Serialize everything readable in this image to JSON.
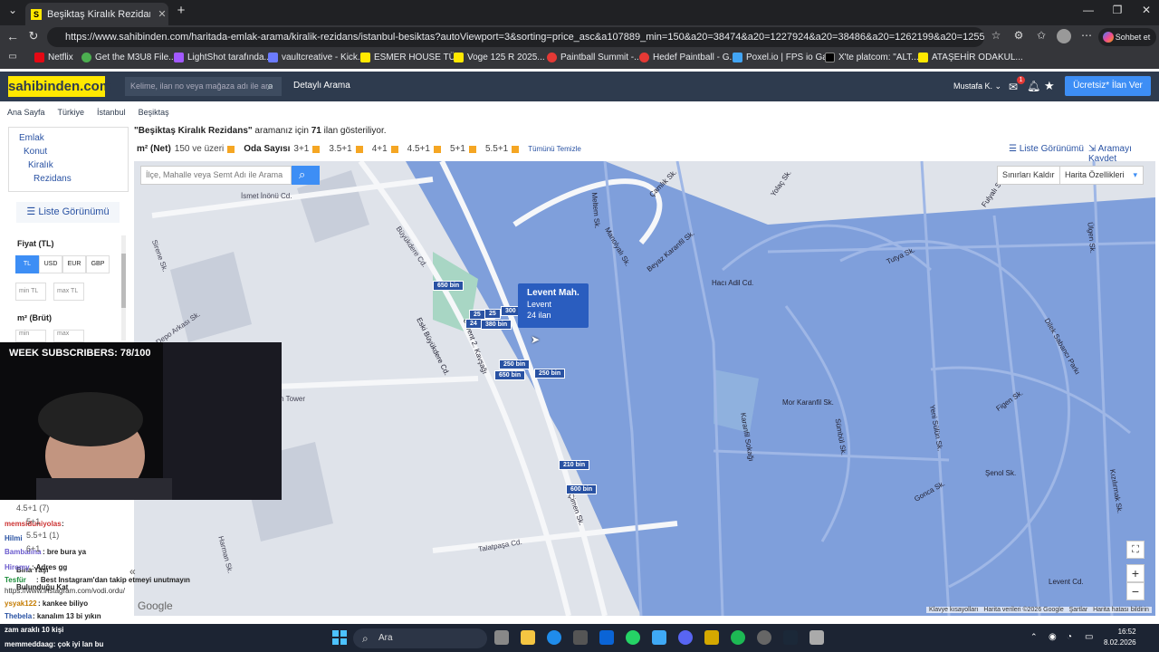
{
  "browser": {
    "tab_title": "Beşiktaş Kiralık Rezidans Fiyatları ",
    "url": "https://www.sahibinden.com/haritada-emlak-arama/kiralik-rezidans/istanbul-besiktas?autoViewport=3&sorting=price_asc&a107889_min=150&a20=38474&a20=1227924&a20=38486&a20=1262199&a20=1255142&a20=38471&a20=122...",
    "profile_btn": "Sohbet et",
    "bookmarks": [
      "Netflix",
      "Get the M3U8 File...",
      "LightShot tarafında...",
      "vaultcreative - Kick...",
      "ESMER HOUSE TÜ...",
      "Voge 125 R 2025...",
      "Paintball Summit -...",
      "Hedef Paintball - G...",
      "Poxel.io | FPS io Ga...",
      "X'te platcom: \"ALT...",
      "ATAŞEHİR ODAKUL..."
    ]
  },
  "header": {
    "logo": "sahibinden.com",
    "search_placeholder": "Kelime, ilan no veya mağaza adı ile ara",
    "detailed_search": "Detaylı Arama",
    "user": "Mustafa K.",
    "notif_count": "1",
    "free_ad": "Ücretsiz* İlan Ver"
  },
  "breadcrumb": [
    "Ana Sayfa",
    "Türkiye",
    "İstanbul",
    "Beşiktaş"
  ],
  "sidebar": {
    "categories": [
      "Emlak",
      "Konut",
      "Kiralık",
      "Rezidans"
    ],
    "list_view": "Liste Görünümü",
    "price_label": "Fiyat (TL)",
    "currencies": [
      "TL",
      "USD",
      "EUR",
      "GBP"
    ],
    "min_tl": "min TL",
    "max_tl": "max TL",
    "area_label": "m² (Brüt)",
    "min": "min",
    "max": "max"
  },
  "results": {
    "query": "\"Beşiktaş Kiralık Rezidans\"",
    "text_pre": " aramanız için ",
    "count": "71",
    "text_post": " ilan gösteriliyor."
  },
  "filters": {
    "net_label": "m² (Net)",
    "net_value": "150 ve üzeri",
    "rooms_label": "Oda Sayısı",
    "rooms": [
      "3+1",
      "3.5+1",
      "4+1",
      "4.5+1",
      "5+1",
      "5.5+1"
    ],
    "clear_all": "Tümünü Temizle",
    "list_view": "Liste Görünümü",
    "save_search": "Aramayı Kaydet"
  },
  "map": {
    "search_placeholder": "İlçe, Mahalle veya Semt  Adı ile Arama",
    "remove_bounds": "Sınırları Kaldır",
    "map_features": "Harita Özellikleri",
    "tooltip": {
      "title": "Levent Mah.",
      "sub": "Levent",
      "count": "24 ilan"
    },
    "pins": [
      "650 bin",
      "25",
      "25",
      "300 b",
      "24",
      "380 bin",
      "250 bin",
      "650 bin",
      "250 bin",
      "210 bin",
      "600 bin"
    ],
    "streets": [
      "İsmet İnönü Cd.",
      "Büyükdere Cd.",
      "Eski Büyükdere Cd.",
      "Levent 2. Kavşağı",
      "Tekfen Tower",
      "Meltem Sk.",
      "Manolyalı Sk.",
      "Beyaz Karanfil Sk.",
      "Çamlık Sk.",
      "Yolaç Sk.",
      "Hacı Adil Cd.",
      "Mor Karanfil Sk.",
      "Sümbül Sk.",
      "Yeni Sülün Sk.",
      "Figen Sk.",
      "Ülgen Sk.",
      "Tutya Sk.",
      "Fulyalı Sk.",
      "Sirene Sk.",
      "Depo Arkası Sk.",
      "Talatpaşa Cd.",
      "Harman Sk.",
      "Dilek Sabancı Parkı",
      "Levent Cd.",
      "Kızılırmak Sk.",
      "Karanfil Sokağı",
      "Gonca Sk.",
      "Şenol Sk.",
      "Çimen Sk."
    ],
    "zoom_in": "+",
    "zoom_out": "−",
    "attribution": [
      "Klavye kısayolları",
      "Harita verileri ©2026 Google",
      "Şartlar",
      "Harita hatası bildirin"
    ],
    "google": "Google"
  },
  "stream": {
    "subs_label": "WEEK SUBSCRIBERS: 78/100",
    "sidebar_rooms": [
      "4.5+1 (7)",
      "5+1",
      "5.5+1 (1)",
      "6+1"
    ],
    "bina_yasi": "Bina Yaşı",
    "bulundugu_kat": "Bulunduğu Kat",
    "chat": [
      {
        "user": "memsiduniyolas",
        "msg": " :"
      },
      {
        "user": "Hilmi",
        "msg": ""
      },
      {
        "user": "Bambalina",
        "msg": " : bre bura ya"
      },
      {
        "user": "Hiromy",
        "msg": " : Adres gg"
      },
      {
        "user": "Tesfür",
        "msg": " : Best Instagram'dan takip etmeyi unutmayın"
      },
      {
        "user": "https://www.instagram.com/vodi.ordu/",
        "msg": ""
      },
      {
        "user": "ysyak122",
        "msg": " : kankee biliyo"
      },
      {
        "user": "Thebela",
        "msg": " : kanalım 13 bi yıkın"
      }
    ],
    "viewers": "zam araklı 10 kişi",
    "bottom_msg": "memmeddaag: çok iyi lan bu"
  },
  "taskbar": {
    "search": "Ara",
    "time": "16:52",
    "date": "8.02.2026"
  }
}
